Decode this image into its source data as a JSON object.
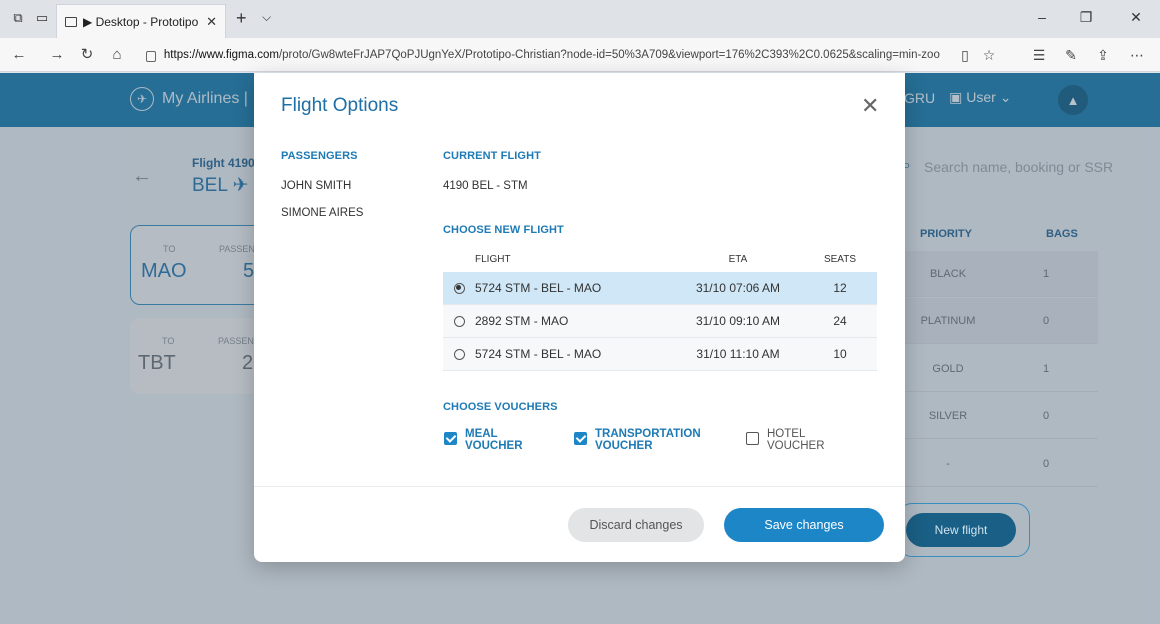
{
  "browser": {
    "tab_title": "▶ Desktop - Prototipo C",
    "url_host": "https://www.figma.com",
    "url_path": "/proto/Gw8wteFrJAP7QoPJUgnYeX/Prototipo-Christian?node-id=50%3A709&viewport=176%2C393%2C0.0625&scaling=min-zoom"
  },
  "app": {
    "brand": "My Airlines |",
    "airport": "GRU",
    "user": "User",
    "flight_label": "Flight 4190",
    "route_label": "BEL ✈",
    "search_placeholder": "Search name, booking or SSR",
    "cards": [
      {
        "to_label": "TO",
        "pass_label": "PASSEN",
        "dest": "MAO",
        "count": "5"
      },
      {
        "to_label": "TO",
        "pass_label": "PASSEN",
        "dest": "TBT",
        "count": "2"
      }
    ],
    "priority_header": "PRIORITY",
    "bags_header": "BAGS",
    "priorities": [
      {
        "name": "BLACK",
        "bags": "1"
      },
      {
        "name": "PLATINUM",
        "bags": "0"
      },
      {
        "name": "GOLD",
        "bags": "1"
      },
      {
        "name": "SILVER",
        "bags": "0"
      },
      {
        "name": "-",
        "bags": "0"
      }
    ],
    "new_flight": "New flight"
  },
  "modal": {
    "title": "Flight Options",
    "passengers_head": "PASSENGERS",
    "passengers": [
      "JOHN SMITH",
      "SIMONE AIRES"
    ],
    "current_head": "CURRENT FLIGHT",
    "current_flight": "4190 BEL - STM",
    "choose_head": "CHOOSE NEW FLIGHT",
    "col_flight": "FLIGHT",
    "col_eta": "ETA",
    "col_seats": "SEATS",
    "flights": [
      {
        "flight": "5724 STM - BEL - MAO",
        "eta": "31/10 07:06 AM",
        "seats": "12",
        "selected": true
      },
      {
        "flight": "2892 STM - MAO",
        "eta": "31/10 09:10 AM",
        "seats": "24",
        "selected": false
      },
      {
        "flight": "5724 STM - BEL - MAO",
        "eta": "31/10 11:10 AM",
        "seats": "10",
        "selected": false
      }
    ],
    "vouchers_head": "CHOOSE VOUCHERS",
    "vouchers": [
      {
        "line1": "MEAL",
        "line2": "VOUCHER",
        "checked": true
      },
      {
        "line1": "TRANSPORTATION",
        "line2": "VOUCHER",
        "checked": true
      },
      {
        "line1": "HOTEL",
        "line2": "VOUCHER",
        "checked": false
      }
    ],
    "discard": "Discard changes",
    "save": "Save changes"
  },
  "colors": {
    "accent": "#1d86c6",
    "header": "#1e7fb0",
    "selected_row": "#cfe7f6"
  }
}
